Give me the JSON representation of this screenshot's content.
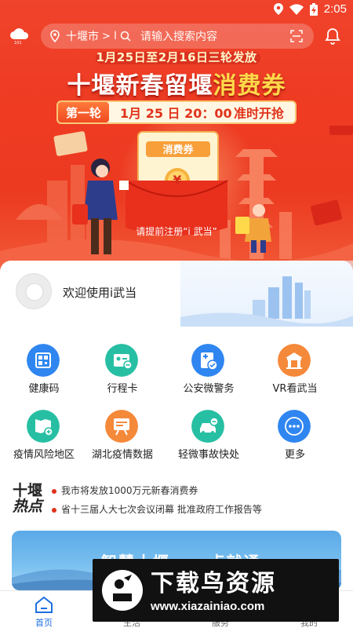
{
  "status_bar": {
    "time": "2:05"
  },
  "header": {
    "city": "十堰市",
    "chevron": ">",
    "separator": "I",
    "search_placeholder": "请输入搜索内容"
  },
  "banner": {
    "subheading": "1月25日至2月16日三轮发放",
    "title_part1": "十堰新春留堰",
    "title_part2": "消费券",
    "round_tag": "第一轮",
    "round_time": "1月 25 日 20：00",
    "round_start": "准时开抢",
    "voucher_label": "消费券",
    "voucher_symbol": "¥",
    "register_note": "请提前注册“i 武当”"
  },
  "welcome": {
    "text": "欢迎使用i武当"
  },
  "services": [
    {
      "label": "健康码",
      "icon": "qr-code-icon",
      "color": "#2f86f0"
    },
    {
      "label": "行程卡",
      "icon": "itinerary-card-icon",
      "color": "#27bfa3"
    },
    {
      "label": "公安微警务",
      "icon": "police-service-icon",
      "color": "#2f86f0"
    },
    {
      "label": "VR看武当",
      "icon": "temple-icon",
      "color": "#f5893a"
    },
    {
      "label": "疫情风险地区",
      "icon": "risk-map-icon",
      "color": "#27bfa3"
    },
    {
      "label": "湖北疫情数据",
      "icon": "data-board-icon",
      "color": "#f5893a"
    },
    {
      "label": "轻微事故快处",
      "icon": "car-accident-icon",
      "color": "#27bfa3"
    },
    {
      "label": "更多",
      "icon": "more-icon",
      "color": "#2f86f0"
    }
  ],
  "hot_news": {
    "logo_line1": "十堰",
    "logo_line2": "热点",
    "items": [
      "我市将发放1000万元新春消费券",
      "省十三届人大七次会议闭幕 批准政府工作报告等"
    ]
  },
  "promo": {
    "text": "智慧十堰 · 一点就通"
  },
  "nav": [
    {
      "label": "首页",
      "active": true
    },
    {
      "label": "生活",
      "active": false
    },
    {
      "label": "服务",
      "active": false
    },
    {
      "label": "我的",
      "active": false
    }
  ],
  "watermark": {
    "title": "下载鸟资源",
    "url": "www.xiazainiao.com"
  }
}
